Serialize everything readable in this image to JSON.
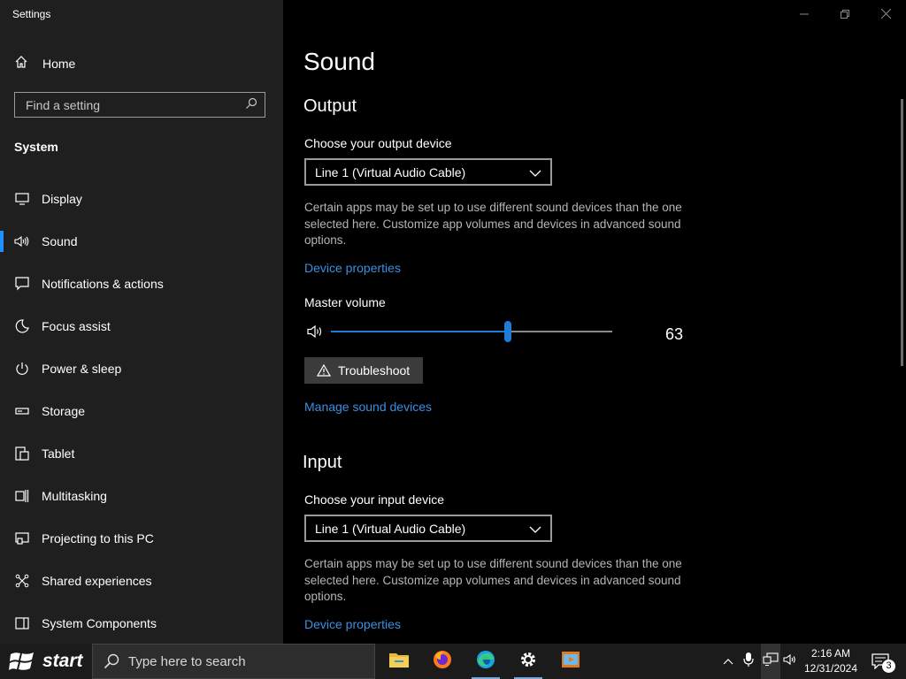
{
  "window": {
    "title": "Settings"
  },
  "sidebar": {
    "home_label": "Home",
    "search_placeholder": "Find a setting",
    "section_label": "System",
    "items": [
      {
        "label": "Display"
      },
      {
        "label": "Sound",
        "active": true
      },
      {
        "label": "Notifications & actions"
      },
      {
        "label": "Focus assist"
      },
      {
        "label": "Power & sleep"
      },
      {
        "label": "Storage"
      },
      {
        "label": "Tablet"
      },
      {
        "label": "Multitasking"
      },
      {
        "label": "Projecting to this PC"
      },
      {
        "label": "Shared experiences"
      },
      {
        "label": "System Components"
      }
    ]
  },
  "main": {
    "title": "Sound",
    "output": {
      "heading": "Output",
      "device_label": "Choose your output device",
      "device_value": "Line 1 (Virtual Audio Cable)",
      "description": "Certain apps may be set up to use different sound devices than the one selected here. Customize app volumes and devices in advanced sound options.",
      "device_properties_link": "Device properties",
      "master_volume_label": "Master volume",
      "volume_value": "63",
      "volume_level": 0.63,
      "troubleshoot_label": "Troubleshoot",
      "manage_link": "Manage sound devices"
    },
    "input": {
      "heading": "Input",
      "device_label": "Choose your input device",
      "device_value": "Line 1 (Virtual Audio Cable)",
      "description": "Certain apps may be set up to use different sound devices than the one selected here. Customize app volumes and devices in advanced sound options.",
      "device_properties_link": "Device properties"
    }
  },
  "taskbar": {
    "start_label": "start",
    "search_placeholder": "Type here to search",
    "time": "2:16 AM",
    "date": "12/31/2024",
    "notification_count": "3"
  },
  "colors": {
    "accent": "#1e7bd8",
    "link": "#3b8fe0",
    "sidebar_bg": "#1f1f1f",
    "main_bg": "#000000"
  }
}
